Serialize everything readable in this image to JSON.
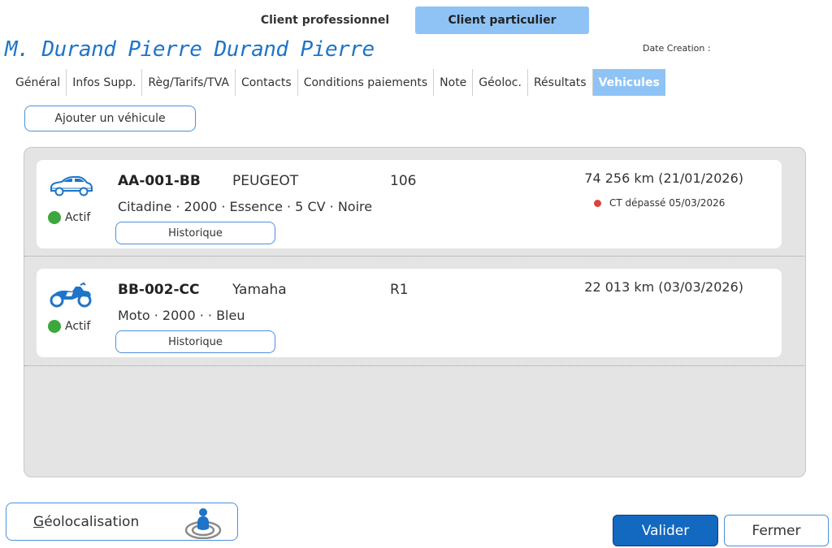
{
  "client_type_tabs": [
    {
      "label": "Client professionnel",
      "active": false
    },
    {
      "label": "Client particulier",
      "active": true
    }
  ],
  "client_name": "M. Durand Pierre Durand Pierre",
  "date_creation_label": "Date Creation :",
  "tabs": [
    {
      "label": "Général"
    },
    {
      "label": "Infos Supp."
    },
    {
      "label": "Règ/Tarifs/TVA"
    },
    {
      "label": "Contacts"
    },
    {
      "label": "Conditions paiements"
    },
    {
      "label": "Note"
    },
    {
      "label": "Géoloc."
    },
    {
      "label": "Résultats"
    },
    {
      "label": "Vehicules",
      "active": true
    }
  ],
  "add_vehicle_label": "Ajouter un véhicule",
  "vehicles": [
    {
      "icon": "car-icon",
      "status": "Actif",
      "status_color": "#3ca83c",
      "plate": "AA-001-BB",
      "brand": "PEUGEOT",
      "model": "106",
      "description": "Citadine · 2000 · Essence · 5 CV · Noire",
      "mileage": "74 256 km (21/01/2026)",
      "alert": "CT dépassé 05/03/2026",
      "alert_color": "#d9453a",
      "history_label": "Historique"
    },
    {
      "icon": "motorcycle-icon",
      "status": "Actif",
      "status_color": "#3ca83c",
      "plate": "BB-002-CC",
      "brand": "Yamaha",
      "model": "R1",
      "description": "Moto · 2000 ·  · Bleu",
      "mileage": "22 013 km (03/03/2026)",
      "history_label": "Historique"
    }
  ],
  "geolocalisation_label": "Géolocalisation",
  "valider_label": "Valider",
  "fermer_label": "Fermer",
  "colors": {
    "accent": "#8fc3f5",
    "primary_button": "#1368c0",
    "title": "#1e74c8"
  }
}
